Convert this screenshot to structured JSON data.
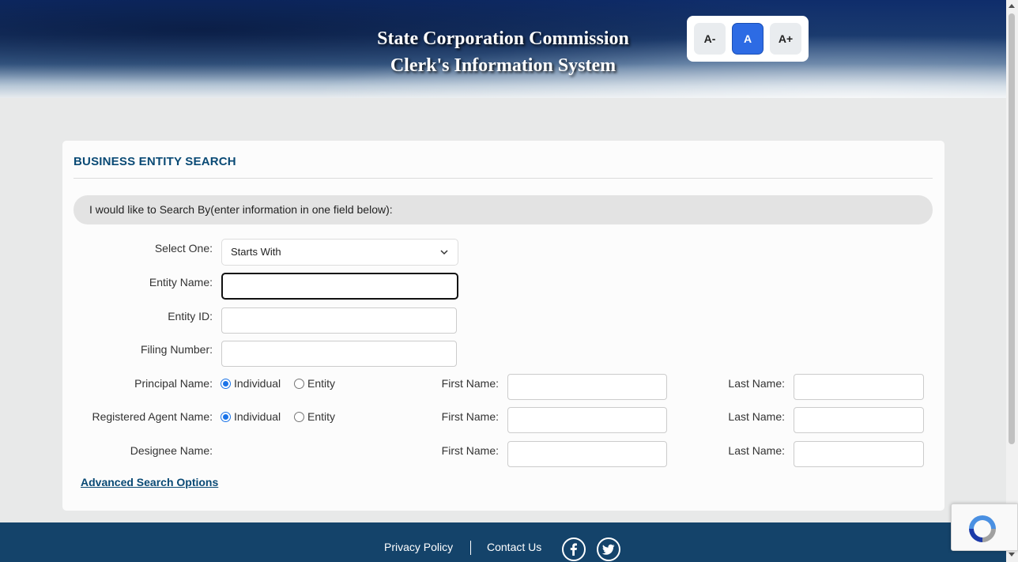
{
  "header": {
    "title_line1": "State Corporation Commission",
    "title_line2": "Clerk's Information System",
    "font_controls": {
      "decrease": "A-",
      "normal": "A",
      "increase": "A+"
    }
  },
  "search": {
    "title": "BUSINESS ENTITY SEARCH",
    "banner": "I would like to Search By(enter information in one field below):",
    "select_label": "Select One:",
    "select_value": "Starts With",
    "entity_name_label": "Entity Name:",
    "entity_name_value": "",
    "entity_id_label": "Entity ID:",
    "entity_id_value": "",
    "filing_number_label": "Filing Number:",
    "filing_number_value": "",
    "principal_label": "Principal Name:",
    "registered_agent_label": "Registered Agent Name:",
    "designee_label": "Designee Name:",
    "radio_individual": "Individual",
    "radio_entity": "Entity",
    "first_name_label": "First Name:",
    "last_name_label": "Last Name:",
    "advanced_link": "Advanced Search Options"
  },
  "footer": {
    "privacy": "Privacy Policy",
    "contact": "Contact Us",
    "icons": [
      "facebook-icon",
      "twitter-icon"
    ]
  },
  "colors": {
    "accent": "#2d6be4",
    "heading": "#0a4a75",
    "footer": "#14436a"
  }
}
